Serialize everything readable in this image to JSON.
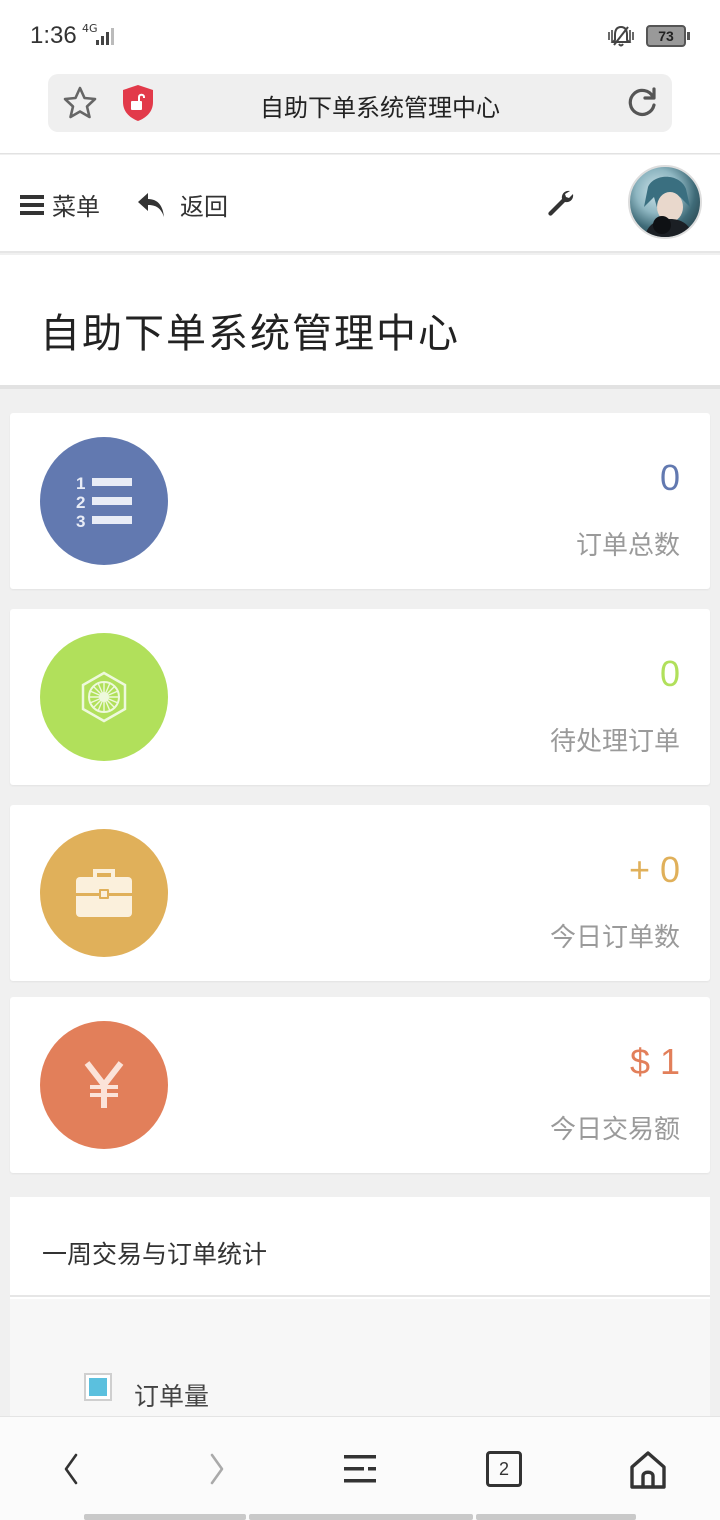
{
  "status": {
    "time": "1:36",
    "network": "4G",
    "battery": "73"
  },
  "browser": {
    "url_title": "自助下单系统管理中心",
    "tab_count": "2"
  },
  "header": {
    "menu_label": "菜单",
    "back_label": "返回"
  },
  "page": {
    "title": "自助下单系统管理中心"
  },
  "stats": [
    {
      "label": "订单总数",
      "value": "0",
      "color": "#6279b0",
      "icon": "numbered-list-icon"
    },
    {
      "label": "待处理订单",
      "value": "0",
      "color": "#b1e05b",
      "icon": "hexagon-sun-icon"
    },
    {
      "label": "今日订单数",
      "value": "+ 0",
      "color": "#e0b05a",
      "icon": "briefcase-icon"
    },
    {
      "label": "今日交易额",
      "value": "$ 1",
      "color": "#e27f5a",
      "icon": "yen-icon"
    }
  ],
  "weekly": {
    "title": "一周交易与订单统计",
    "legend_label": "订单量",
    "legend_color": "#5bc0de"
  }
}
